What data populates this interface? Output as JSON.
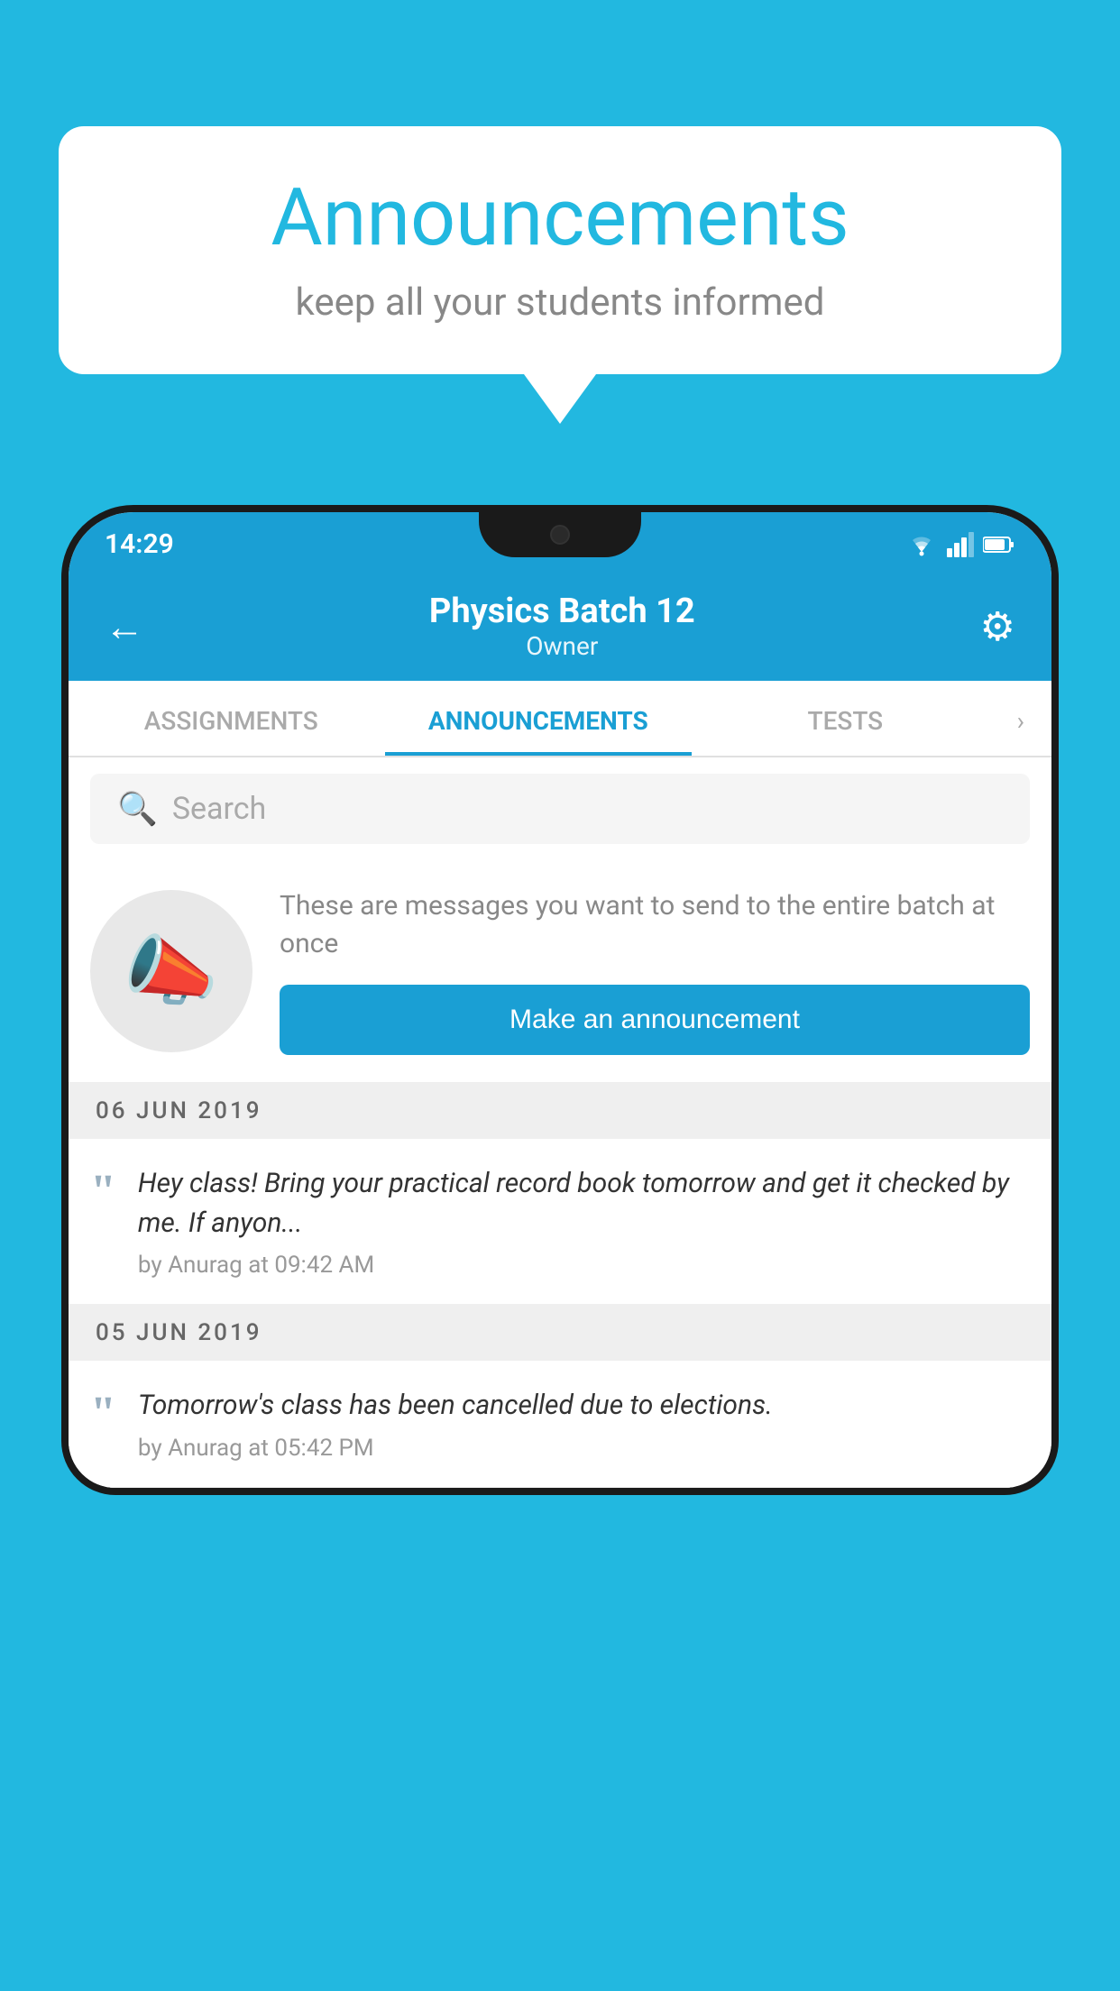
{
  "background_color": "#22b8e0",
  "speech_bubble": {
    "title": "Announcements",
    "subtitle": "keep all your students informed"
  },
  "phone": {
    "status_bar": {
      "time": "14:29",
      "icons": "wifi signal battery"
    },
    "header": {
      "back_label": "←",
      "title": "Physics Batch 12",
      "subtitle": "Owner",
      "gear_label": "⚙"
    },
    "tabs": [
      {
        "label": "ASSIGNMENTS",
        "active": false
      },
      {
        "label": "ANNOUNCEMENTS",
        "active": true
      },
      {
        "label": "TESTS",
        "active": false
      }
    ],
    "search": {
      "placeholder": "Search"
    },
    "announcement_prompt": {
      "description": "These are messages you want to send to the entire batch at once",
      "button_label": "Make an announcement"
    },
    "announcements": [
      {
        "date": "06  JUN  2019",
        "text": "Hey class! Bring your practical record book tomorrow and get it checked by me. If anyon...",
        "meta": "by Anurag at 09:42 AM"
      },
      {
        "date": "05  JUN  2019",
        "text": "Tomorrow's class has been cancelled due to elections.",
        "meta": "by Anurag at 05:42 PM"
      }
    ]
  }
}
